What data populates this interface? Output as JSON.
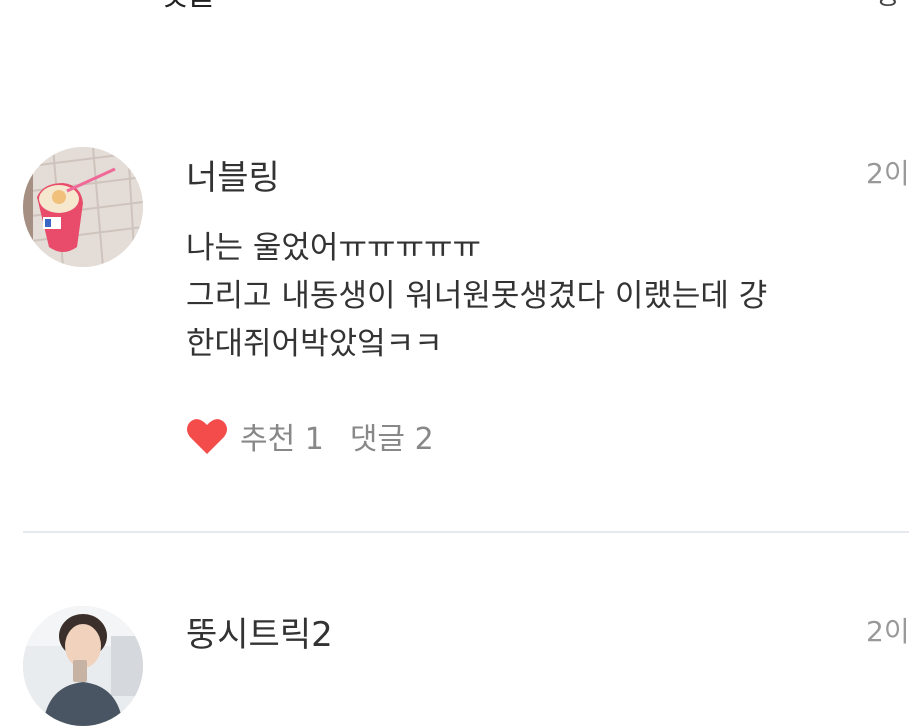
{
  "header": {
    "title": "댓글",
    "right_label": "등"
  },
  "comments": [
    {
      "username": "너블링",
      "time": "2이",
      "body_lines": [
        "나는 울었어ㅠㅠㅠㅠㅠ",
        "그리고 내동생이 워너원못생겼다 이랬는데 걍",
        "한대쥐어박았엌ㅋㅋ"
      ],
      "likes_label": "추천 1",
      "replies_label": "댓글 2"
    },
    {
      "username": "뚱시트릭2",
      "time": "2이"
    }
  ],
  "colors": {
    "heart": "#f44b4b",
    "divider": "#e6e9ee",
    "muted_text": "#888888"
  }
}
